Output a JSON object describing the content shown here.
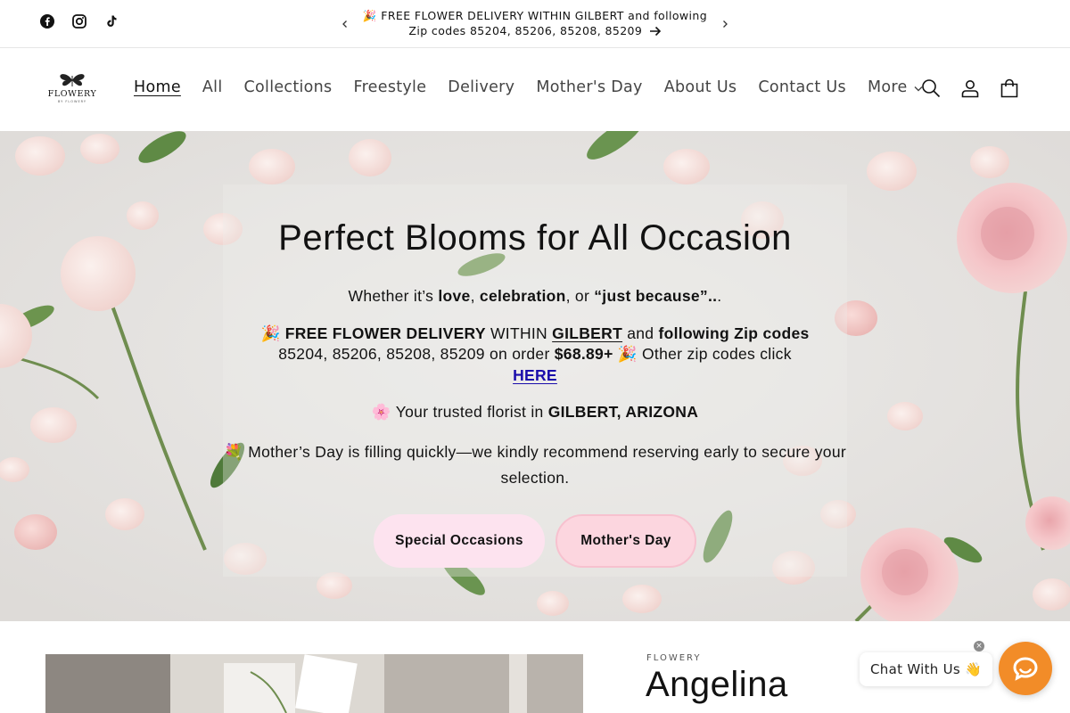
{
  "announcement": {
    "line1": "🎉 FREE FLOWER DELIVERY WITHIN GILBERT and following",
    "line2": "Zip codes 85204, 85206, 85208, 85209"
  },
  "social": [
    "facebook-icon",
    "instagram-icon",
    "tiktok-icon"
  ],
  "logo": {
    "word": "FLOWERY",
    "sub": "BY FLOWERY"
  },
  "nav": {
    "items": [
      "Home",
      "All",
      "Collections",
      "Freestyle",
      "Delivery",
      "Mother's Day",
      "About Us",
      "Contact Us",
      "More"
    ],
    "active": "Home"
  },
  "header_icons": [
    "search-icon",
    "account-icon",
    "cart-icon"
  ],
  "hero": {
    "title": "Perfect Blooms for All Occasion",
    "p1": {
      "a": "Whether it’s ",
      "b": "love",
      "c": ", ",
      "d": "celebration",
      "e": ", or ",
      "f": "“just because”..",
      "g": "."
    },
    "p2": {
      "emoji": "🎉 ",
      "a": "FREE FLOWER DELIVERY",
      "b": " WITHIN ",
      "c": "GILBERT",
      "d": " and ",
      "e": "following Zip codes",
      "f": "85204, 85206, 85208, 85209 on order ",
      "g": "$68.89+",
      "h": " 🎉 Other zip codes click",
      "link": "HERE"
    },
    "p3": {
      "emoji": "🌸 ",
      "a": "Your trusted florist in ",
      "b": "GILBERT, ARIZONA"
    },
    "p4": {
      "emoji": "💐 ",
      "a": "Mother’s Day is filling quickly—we kindly recommend reserving early to secure your selection."
    },
    "buttons": [
      "Special Occasions",
      "Mother's Day"
    ]
  },
  "product": {
    "vendor": "FLOWERY",
    "title": "Angelina"
  },
  "chat": {
    "label": "Chat With Us 👋",
    "close": "×"
  },
  "colors": {
    "chat_orange": "#f28c28",
    "btn_pink_light": "#fde3ef",
    "btn_pink": "#fcd6df",
    "link_blue": "#1a0dab"
  }
}
